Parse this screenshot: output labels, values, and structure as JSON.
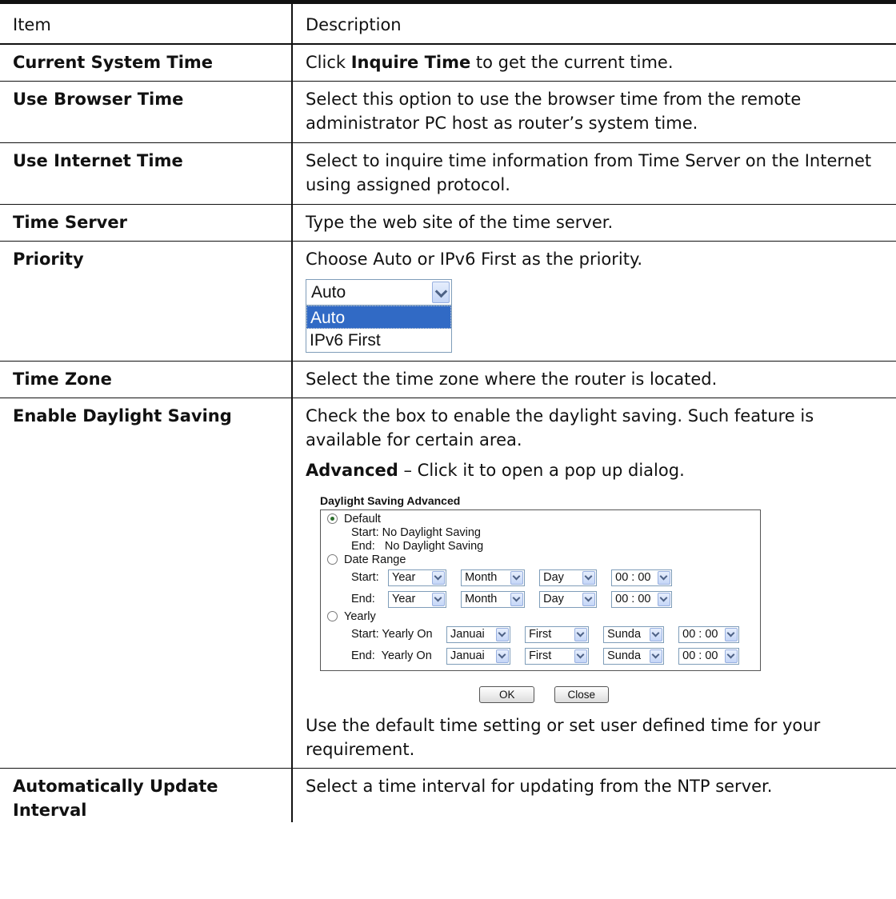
{
  "header": {
    "item": "Item",
    "description": "Description"
  },
  "rows": {
    "current_time": {
      "item": "Current System Time",
      "pre": "Click ",
      "bold": "Inquire Time",
      "post": " to get the current time."
    },
    "browser_time": {
      "item": "Use Browser Time",
      "desc": "Select this option to use the browser time from the remote administrator PC host as router’s system time."
    },
    "internet_time": {
      "item": "Use Internet Time",
      "desc": "Select to inquire time information from Time Server on the Internet using assigned protocol."
    },
    "time_server": {
      "item": "Time Server",
      "desc": "Type the web site of the time server."
    },
    "priority": {
      "item": "Priority",
      "desc": "Choose Auto or IPv6 First as the priority.",
      "select_value": "Auto",
      "options": [
        "Auto",
        "IPv6 First"
      ]
    },
    "time_zone": {
      "item": "Time Zone",
      "desc": "Select the time zone where the router is located."
    },
    "daylight": {
      "item": "Enable Daylight Saving",
      "desc": "Check the box to enable the daylight saving. Such feature is available for certain area.",
      "adv_bold": "Advanced",
      "adv_rest": " – Click it to open a pop up dialog.",
      "footer": "Use the default time setting or set user defined time for your requirement."
    },
    "auto_update": {
      "item": "Automatically Update Interval",
      "desc": "Select a time interval for updating from the NTP server."
    }
  },
  "dialog": {
    "title": "Daylight Saving Advanced",
    "default_label": "Default",
    "default_start": "Start: No Daylight Saving",
    "default_end": "End:   No Daylight Saving",
    "range_label": "Date Range",
    "start_label": "Start:",
    "end_label": "End:",
    "year": "Year",
    "month": "Month",
    "day": "Day",
    "time": "00 : 00",
    "yearly_label": "Yearly",
    "yearly_start": "Start: Yearly On",
    "yearly_end": "End:  Yearly On",
    "yearly_month": "Januai",
    "yearly_week": "First",
    "yearly_day": "Sunda",
    "ok": "OK",
    "close": "Close"
  }
}
